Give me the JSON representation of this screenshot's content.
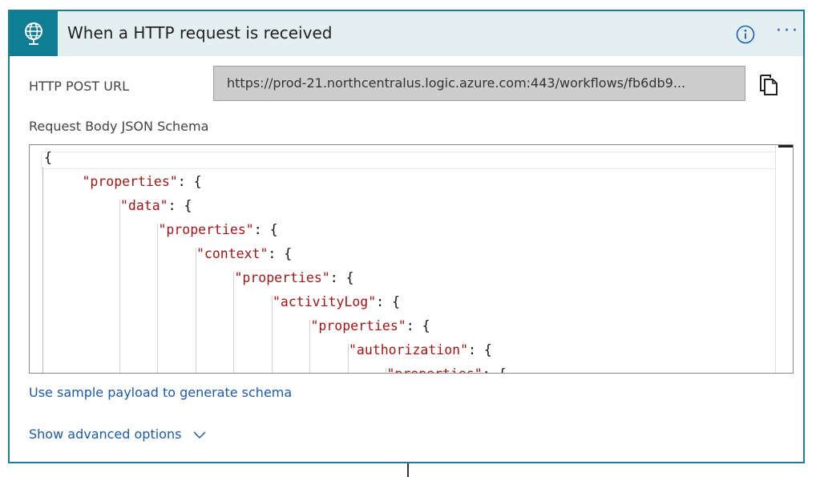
{
  "header": {
    "title": "When a HTTP request is received",
    "trigger_icon": "globe-request-icon",
    "info_icon": "info-icon",
    "more_icon": "more-dots-icon",
    "more_label": "···"
  },
  "http_post_url": {
    "label": "HTTP POST URL",
    "value": "https://prod-21.northcentralus.logic.azure.com:443/workflows/fb6db9...",
    "copy_icon": "copy-icon"
  },
  "schema": {
    "label": "Request Body JSON Schema",
    "lines": [
      {
        "key": "",
        "punct": "{"
      },
      {
        "key": "\"properties\"",
        "punct": ": {"
      },
      {
        "key": "\"data\"",
        "punct": ": {"
      },
      {
        "key": "\"properties\"",
        "punct": ": {"
      },
      {
        "key": "\"context\"",
        "punct": ": {"
      },
      {
        "key": "\"properties\"",
        "punct": ": {"
      },
      {
        "key": "\"activityLog\"",
        "punct": ": {"
      },
      {
        "key": "\"properties\"",
        "punct": ": {"
      },
      {
        "key": "\"authorization\"",
        "punct": ": {"
      },
      {
        "key": "\"properties\"",
        "punct": ": {"
      }
    ]
  },
  "links": {
    "sample_payload": "Use sample payload to generate schema",
    "advanced_options": "Show advanced options"
  },
  "colors": {
    "accent": "#0f7d93",
    "header_bg": "#e3eff1",
    "link": "#1a5aa8",
    "json_key": "#a31515"
  }
}
